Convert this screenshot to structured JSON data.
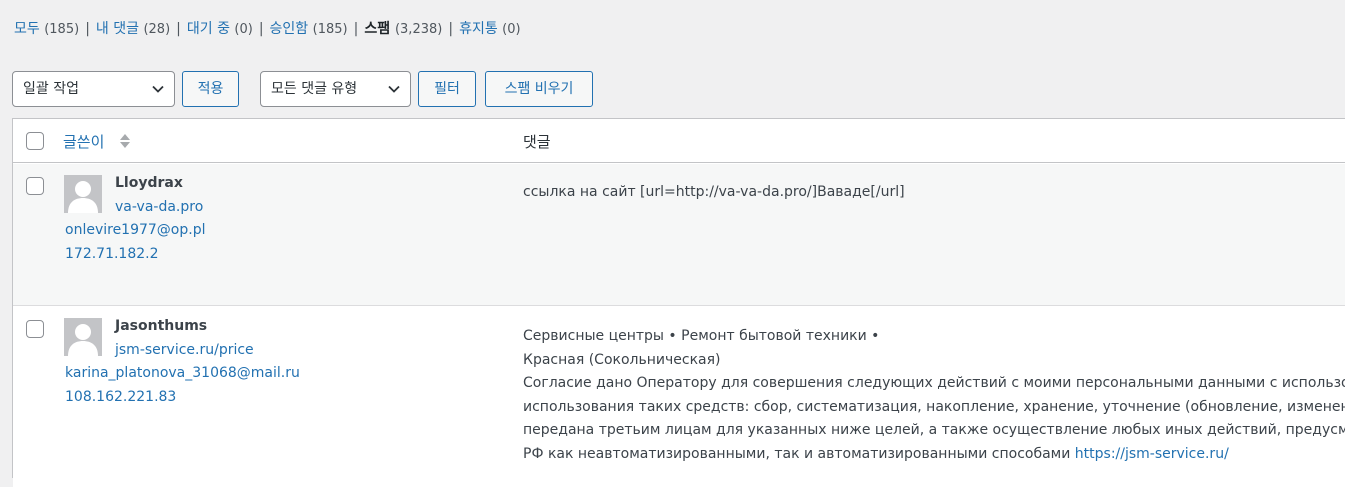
{
  "status_links": [
    {
      "label": "모두",
      "count": "(185)",
      "current": false
    },
    {
      "label": "내 댓글",
      "count": "(28)",
      "current": false
    },
    {
      "label": "대기 중",
      "count": "(0)",
      "current": false
    },
    {
      "label": "승인함",
      "count": "(185)",
      "current": false
    },
    {
      "label": "스팸",
      "count": "(3,238)",
      "current": true
    },
    {
      "label": "휴지통",
      "count": "(0)",
      "current": false
    }
  ],
  "separator": "|",
  "tablenav": {
    "bulk_action": "일괄 작업",
    "apply": "적용",
    "comment_type": "모든 댓글 유형",
    "filter": "필터",
    "empty_spam": "스팸 비우기"
  },
  "columns": {
    "author": "글쓴이",
    "comment": "댓글"
  },
  "comments": [
    {
      "author": "Lloydrax",
      "url": "va-va-da.pro",
      "email": "onlevire1977@op.pl",
      "ip": "172.71.182.2",
      "lines": [
        "ссылка на сайт [url=http://va-va-da.pro/]Ваваде[/url]"
      ]
    },
    {
      "author": "Jasonthums",
      "url": "jsm-service.ru/price",
      "email": "karina_platonova_31068@mail.ru",
      "ip": "108.162.221.83",
      "lines": [
        "Сервисные центры • Ремонт бытовой техники •",
        "Красная (Сокольническая)",
        "Согласие дано Оператору для совершения следующих действий с моими персональными данными с использован",
        "использования таких средств: сбор, систематизация, накопление, хранение, уточнение (обновление, изменение), и",
        "передана третьим лицам для указанных ниже целей, а также осуществление любых иных действий, предусмотрен",
        "РФ как неавтоматизированными, так и автоматизированными способами "
      ],
      "link": "https://jsm-service.ru/"
    }
  ]
}
